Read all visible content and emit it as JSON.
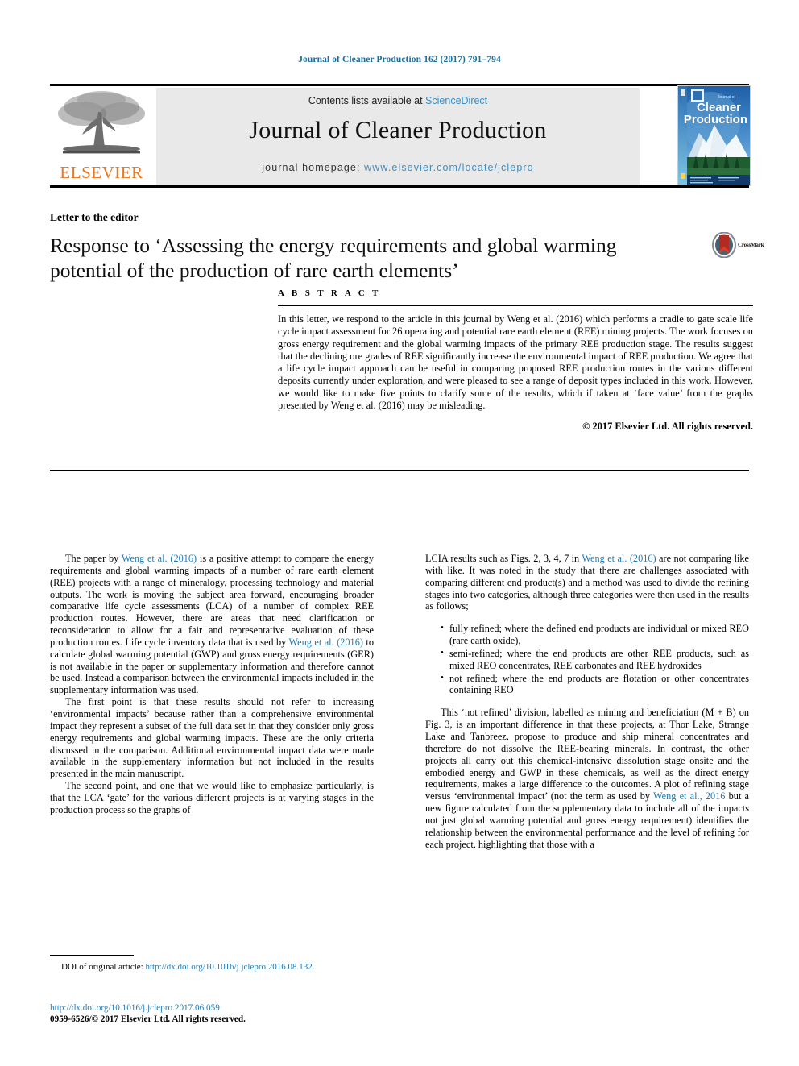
{
  "running_head": "Journal of Cleaner Production 162 (2017) 791–794",
  "masthead": {
    "contents_prefix": "Contents lists available at ",
    "sciencedirect": "ScienceDirect",
    "journal_title": "Journal of Cleaner Production",
    "homepage_prefix": "journal homepage: ",
    "homepage_url": "www.elsevier.com/locate/jclepro",
    "publisher_logo_text": "ELSEVIER",
    "cover_line1": "Journal of",
    "cover_line2": "Cleaner",
    "cover_line3": "Production",
    "link_color": "#3a8fc4",
    "band_color": "#e9e9e9",
    "elsevier_orange": "#e87722"
  },
  "article": {
    "type": "Letter to the editor",
    "title": "Response to ‘Assessing the energy requirements and global warming potential of the production of rare earth elements’",
    "crossmark_label": "CrossMark"
  },
  "abstract": {
    "heading": "A B S T R A C T",
    "body": "In this letter, we respond to the article in this journal by Weng et al. (2016) which performs a cradle to gate scale life cycle impact assessment for 26 operating and potential rare earth element (REE) mining projects. The work focuses on gross energy requirement and the global warming impacts of the primary REE production stage. The results suggest that the declining ore grades of REE significantly increase the environmental impact of REE production. We agree that a life cycle impact approach can be useful in comparing proposed REE production routes in the various different deposits currently under exploration, and were pleased to see a range of deposit types included in this work. However, we would like to make five points to clarify some of the results, which if taken at ‘face value’ from the graphs presented by Weng et al. (2016) may be misleading.",
    "copyright": "© 2017 Elsevier Ltd. All rights reserved."
  },
  "body": {
    "left": {
      "p1_a": "The paper by ",
      "p1_link": "Weng et al. (2016)",
      "p1_b": " is a positive attempt to compare the energy requirements and global warming impacts of a number of rare earth element (REE) projects with a range of mineralogy, processing technology and material outputs. The work is moving the subject area forward, encouraging broader comparative life cycle assessments (LCA) of a number of complex REE production routes. However, there are areas that need clarification or reconsideration to allow for a fair and representative evaluation of these production routes. Life cycle inventory data that is used by ",
      "p1_link2": "Weng et al. (2016)",
      "p1_c": " to calculate global warming potential (GWP) and gross energy requirements (GER) is not available in the paper or supplementary information and therefore cannot be used. Instead a comparison between the environmental impacts included in the supplementary information was used.",
      "p2": "The first point is that these results should not refer to increasing ‘environmental impacts’ because rather than a comprehensive environmental impact they represent a subset of the full data set in that they consider only gross energy requirements and global warming impacts. These are the only criteria discussed in the comparison. Additional environmental impact data were made available in the supplementary information but not included in the results presented in the main manuscript.",
      "p3": "The second point, and one that we would like to emphasize particularly, is that the LCA ‘gate’ for the various different projects is at varying stages in the production process so the graphs of"
    },
    "right": {
      "p1_a": "LCIA results such as Figs. 2, 3, 4, 7 in ",
      "p1_link": "Weng et al. (2016)",
      "p1_b": " are not comparing like with like. It was noted in the study that there are challenges associated with comparing different end product(s) and a method was used to divide the refining stages into two categories, although three categories were then used in the results as follows;",
      "bullets": [
        "fully refined; where the defined end products are individual or mixed REO (rare earth oxide),",
        "semi-refined; where the end products are other REE products, such as mixed REO concentrates, REE carbonates and REE hydroxides",
        "not refined; where the end products are flotation or other concentrates containing REO"
      ],
      "p2_a": "This ‘not refined’ division, labelled as mining and beneficiation (M + B) on Fig. 3, is an important difference in that these projects, at Thor Lake, Strange Lake and Tanbreez, propose to produce and ship mineral concentrates and therefore do not dissolve the REE-bearing minerals. In contrast, the other projects all carry out this chemical-intensive dissolution stage onsite and the embodied energy and GWP in these chemicals, as well as the direct energy requirements, makes a large difference to the outcomes. A plot of refining stage versus ‘environmental impact’ (not the term as used by ",
      "p2_link": "Weng et al., 2016",
      "p2_b": " but a new figure calculated from the supplementary data to include all of the impacts not just global warming potential and gross energy requirement) identifies the relationship between the environmental performance and the level of refining for each project, highlighting that those with a"
    }
  },
  "footer": {
    "doi_note_label": "DOI of original article: ",
    "doi_note_url": "http://dx.doi.org/10.1016/j.jclepro.2016.08.132",
    "doi_note_suffix": ".",
    "article_doi": "http://dx.doi.org/10.1016/j.jclepro.2017.06.059",
    "issn_line": "0959-6526/© 2017 Elsevier Ltd. All rights reserved."
  }
}
